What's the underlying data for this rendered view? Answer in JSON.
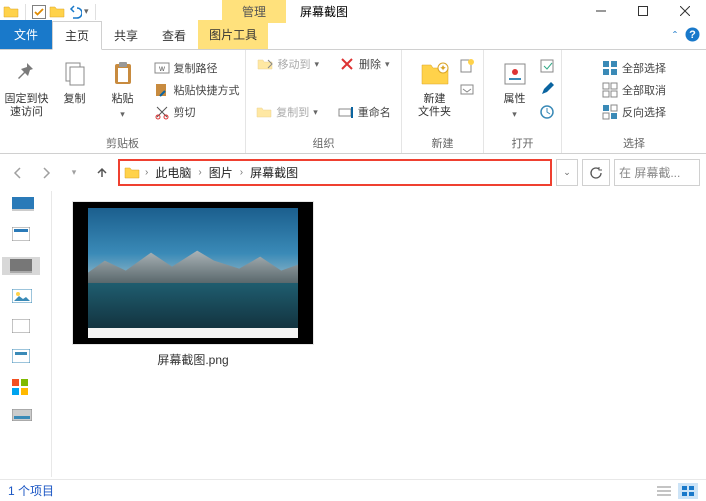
{
  "titlebar": {
    "contextual_tab": "管理",
    "window_title": "屏幕截图"
  },
  "tabs": {
    "file": "文件",
    "home": "主页",
    "share": "共享",
    "view": "查看",
    "tools": "图片工具"
  },
  "ribbon": {
    "pin": "固定到快\n速访问",
    "copy": "复制",
    "paste": "粘贴",
    "cut": "剪切",
    "copy_path": "复制路径",
    "paste_shortcut": "粘贴快捷方式",
    "clipboard_group": "剪贴板",
    "move_to": "移动到",
    "copy_to": "复制到",
    "delete": "删除",
    "rename": "重命名",
    "organize_group": "组织",
    "new_folder": "新建\n文件夹",
    "new_group": "新建",
    "properties": "属性",
    "open_group": "打开",
    "select_all": "全部选择",
    "select_none": "全部取消",
    "invert_selection": "反向选择",
    "select_group": "选择"
  },
  "breadcrumb": {
    "parts": [
      "此电脑",
      "图片",
      "屏幕截图"
    ]
  },
  "search": {
    "placeholder": "在 屏幕截..."
  },
  "file_item": {
    "name": "屏幕截图.png"
  },
  "status": {
    "text": "1 个项目"
  }
}
